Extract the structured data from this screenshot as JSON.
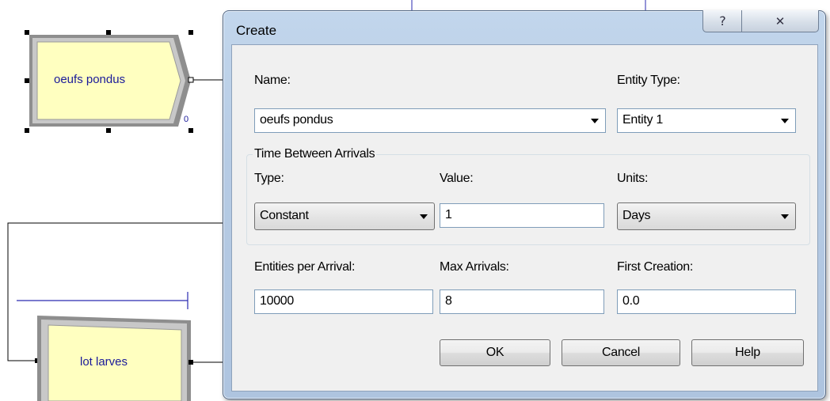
{
  "canvas": {
    "modules": [
      {
        "name": "oeufs pondus",
        "connector_count": "0"
      },
      {
        "name": "lot larves"
      }
    ]
  },
  "dialog": {
    "title": "Create",
    "help_glyph": "?",
    "close_glyph": "✕",
    "name_label": "Name:",
    "name_value": "oeufs pondus",
    "entity_type_label": "Entity Type:",
    "entity_type_value": "Entity 1",
    "group_title": "Time Between Arrivals",
    "type_label": "Type:",
    "type_value": "Constant",
    "value_label": "Value:",
    "value_value": "1",
    "units_label": "Units:",
    "units_value": "Days",
    "entities_per_arrival_label": "Entities per Arrival:",
    "entities_per_arrival_value": "10000",
    "max_arrivals_label": "Max Arrivals:",
    "max_arrivals_value": "8",
    "first_creation_label": "First Creation:",
    "first_creation_value": "0.0",
    "ok_label": "OK",
    "cancel_label": "Cancel",
    "help_label": "Help"
  },
  "colors": {
    "module_fill": "#ffffc0",
    "module_text": "#1a1a9a",
    "dialog_frame": "#b6cbe4",
    "dialog_client": "#f0f0f0"
  }
}
